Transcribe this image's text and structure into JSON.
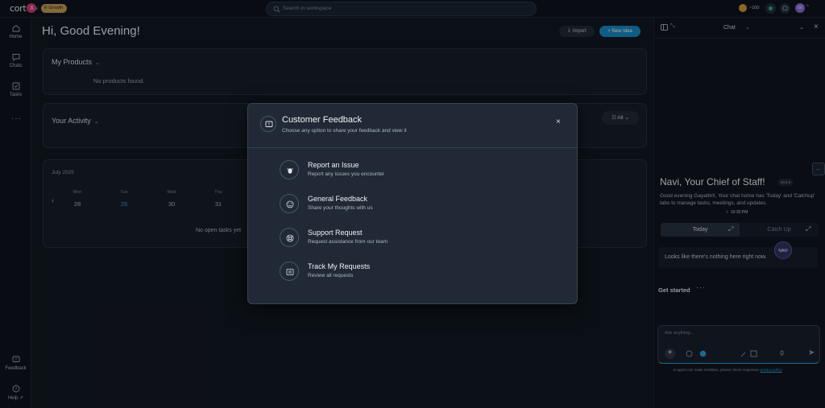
{
  "topbar": {
    "logo_text": "cort",
    "logo_badge": "X",
    "logo_ai": "ai",
    "growth_badge": "Growth",
    "search_placeholder": "Search in workspace",
    "coin_value": "~100",
    "avatar_initials": "GI"
  },
  "sidebar": {
    "items": [
      {
        "label": "Home",
        "icon": "home-icon"
      },
      {
        "label": "Chats",
        "icon": "chat-icon"
      },
      {
        "label": "Tasks",
        "icon": "check-square-icon"
      },
      {
        "label": "Feedback",
        "icon": "feedback-icon"
      },
      {
        "label": "Help",
        "icon": "help-icon"
      }
    ]
  },
  "main": {
    "greeting": "Hi, Good Evening!",
    "import_label": "Import",
    "new_idea_label": "+ New Idea",
    "products": {
      "title": "My Products",
      "empty": "No products found."
    },
    "activity": {
      "title": "Your Activity",
      "filter": "All"
    },
    "calendar": {
      "month": "July 2025",
      "days": [
        {
          "name": "Mon",
          "date": "28"
        },
        {
          "name": "Tue",
          "date": "29"
        },
        {
          "name": "Wed",
          "date": "30"
        },
        {
          "name": "Thu",
          "date": "31"
        }
      ],
      "empty": "No open tasks yet"
    }
  },
  "modal": {
    "title": "Customer Feedback",
    "subtitle": "Choose any option to share your feedback and view it",
    "close": "×",
    "options": [
      {
        "title": "Report an Issue",
        "desc": "Report any issues you encounter",
        "icon": "bug-icon"
      },
      {
        "title": "General Feedback",
        "desc": "Share your thoughts with us",
        "icon": "smile-icon"
      },
      {
        "title": "Support Request",
        "desc": "Request assistance from our team",
        "icon": "lifebuoy-icon"
      },
      {
        "title": "Track My Requests",
        "desc": "Review all requests",
        "icon": "list-icon"
      }
    ]
  },
  "chat_panel": {
    "header": "Chat",
    "navi_title": "Navi, Your Chief of Staff!",
    "version": "v0.5.0",
    "description": "Good evening Gayathri!, Your chat home has 'Today' and 'Catchup' tabs to manage tasks, meetings, and updates.",
    "time": "10:30 PM",
    "tabs": [
      "Today",
      "Catch Up"
    ],
    "empty_message": "Looks like there's nothing here right now.",
    "mascot_label": "NAVI",
    "get_started": "Get started",
    "input_placeholder": "Ask anything...",
    "disclaimer_text": "AI agent can make mistakes, please check responses",
    "disclaimer_link": "privacy policy"
  },
  "colors": {
    "accent": "#1689c4",
    "background": "#0f141b",
    "modal": "#202935"
  }
}
